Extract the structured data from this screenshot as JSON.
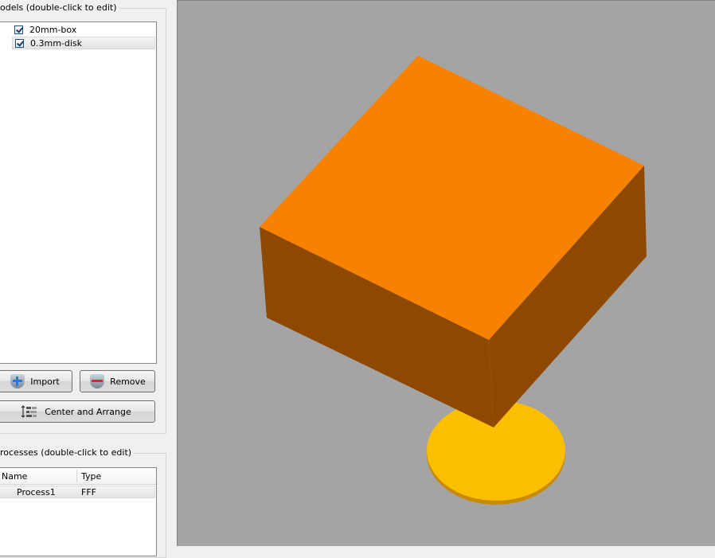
{
  "models_panel": {
    "title": "odels (double-click to edit)",
    "items": [
      {
        "name": "20mm-box",
        "checked": true
      },
      {
        "name": "0.3mm-disk",
        "checked": true
      }
    ],
    "import_label": "Import",
    "remove_label": "Remove",
    "arrange_label": "Center and Arrange"
  },
  "processes_panel": {
    "title": "rocesses (double-click to edit)",
    "columns": [
      "Name",
      "Type"
    ],
    "rows": [
      {
        "name": "Process1",
        "type": "FFF"
      }
    ]
  },
  "viewport": {
    "background": "#a4a4a4",
    "objects": [
      {
        "name": "20mm-box",
        "top_color": "#f78200",
        "side_color": "#8e4800"
      },
      {
        "name": "0.3mm-disk",
        "top_color": "#fbbe00",
        "edge_color": "#c98a00"
      }
    ]
  }
}
